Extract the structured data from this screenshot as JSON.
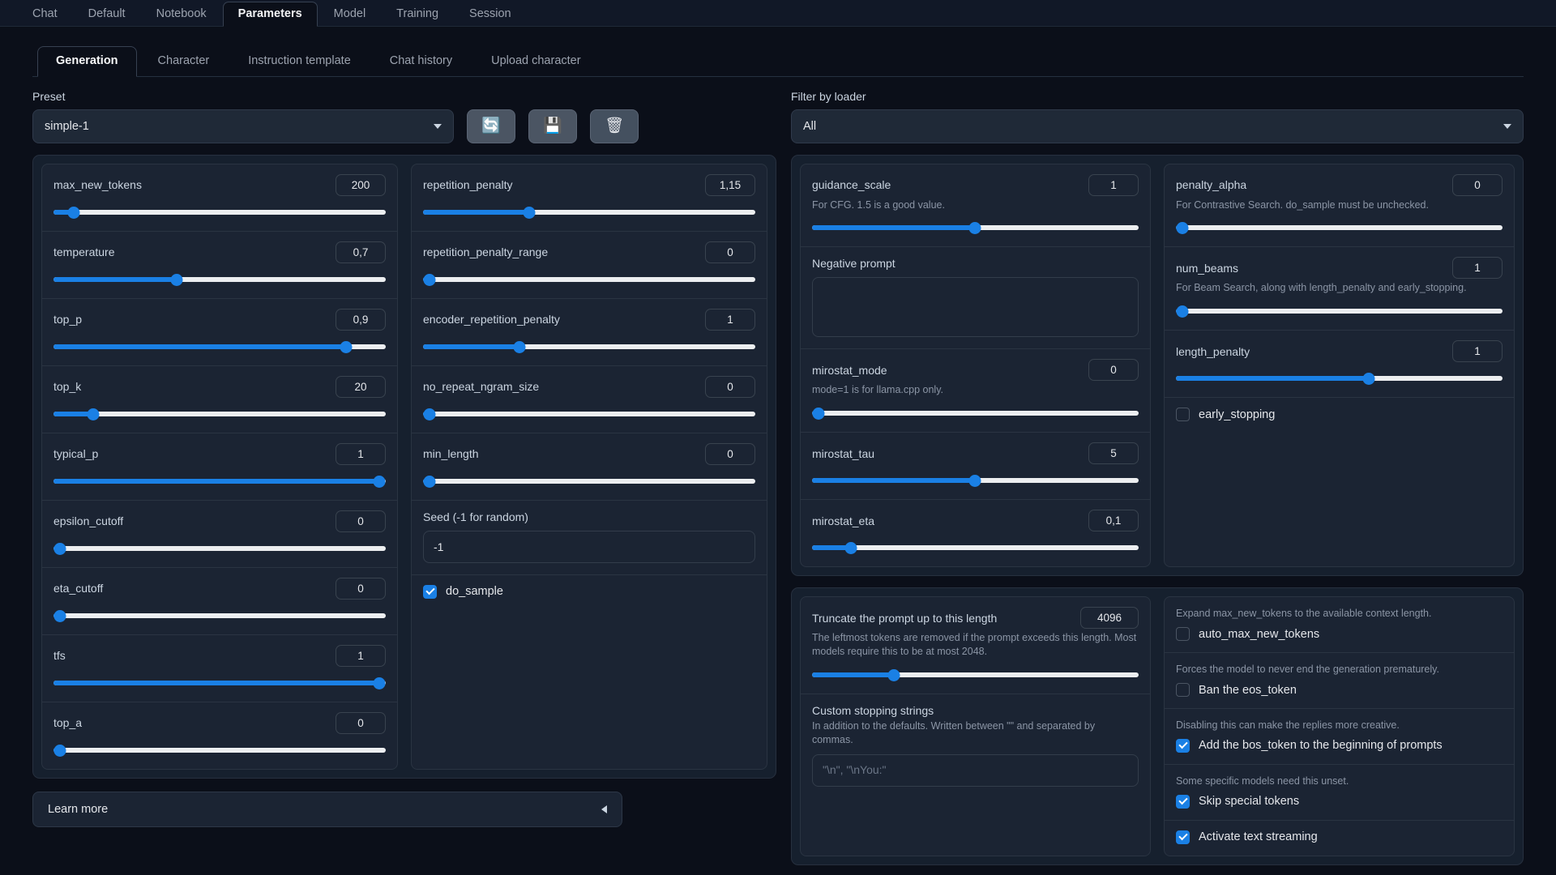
{
  "topnav": {
    "tabs": [
      {
        "label": "Chat",
        "active": false
      },
      {
        "label": "Default",
        "active": false
      },
      {
        "label": "Notebook",
        "active": false
      },
      {
        "label": "Parameters",
        "active": true
      },
      {
        "label": "Model",
        "active": false
      },
      {
        "label": "Training",
        "active": false
      },
      {
        "label": "Session",
        "active": false
      }
    ]
  },
  "subnav": {
    "tabs": [
      {
        "label": "Generation",
        "active": true
      },
      {
        "label": "Character",
        "active": false
      },
      {
        "label": "Instruction template",
        "active": false
      },
      {
        "label": "Chat history",
        "active": false
      },
      {
        "label": "Upload character",
        "active": false
      }
    ]
  },
  "preset": {
    "label": "Preset",
    "value": "simple-1",
    "buttons": [
      {
        "name": "refresh-preset-button",
        "glyph": "🔄"
      },
      {
        "name": "save-preset-button",
        "glyph": "💾"
      },
      {
        "name": "delete-preset-button",
        "glyph": "🗑"
      }
    ]
  },
  "loader_filter": {
    "label": "Filter by loader",
    "value": "All"
  },
  "column_a": [
    {
      "name": "max_new_tokens",
      "value": "200",
      "pct": 6
    },
    {
      "name": "temperature",
      "value": "0,7",
      "pct": 37
    },
    {
      "name": "top_p",
      "value": "0,9",
      "pct": 88
    },
    {
      "name": "top_k",
      "value": "20",
      "pct": 12
    },
    {
      "name": "typical_p",
      "value": "1",
      "pct": 98
    },
    {
      "name": "epsilon_cutoff",
      "value": "0",
      "pct": 2
    },
    {
      "name": "eta_cutoff",
      "value": "0",
      "pct": 2
    },
    {
      "name": "tfs",
      "value": "1",
      "pct": 98
    },
    {
      "name": "top_a",
      "value": "0",
      "pct": 2
    }
  ],
  "column_b": [
    {
      "name": "repetition_penalty",
      "value": "1,15",
      "pct": 32
    },
    {
      "name": "repetition_penalty_range",
      "value": "0",
      "pct": 2
    },
    {
      "name": "encoder_repetition_penalty",
      "value": "1",
      "pct": 29
    },
    {
      "name": "no_repeat_ngram_size",
      "value": "0",
      "pct": 2
    },
    {
      "name": "min_length",
      "value": "0",
      "pct": 2
    }
  ],
  "seed": {
    "label": "Seed (-1 for random)",
    "value": "-1"
  },
  "do_sample": {
    "label": "do_sample",
    "checked": true
  },
  "learn_more": {
    "label": "Learn more"
  },
  "column_c": {
    "guidance_scale": {
      "name": "guidance_scale",
      "value": "1",
      "hint": "For CFG. 1.5 is a good value.",
      "pct": 50
    },
    "negative_prompt": {
      "label": "Negative prompt",
      "value": ""
    },
    "mirostat_mode": {
      "name": "mirostat_mode",
      "value": "0",
      "hint": "mode=1 is for llama.cpp only.",
      "pct": 2
    },
    "mirostat_tau": {
      "name": "mirostat_tau",
      "value": "5",
      "pct": 50
    },
    "mirostat_eta": {
      "name": "mirostat_eta",
      "value": "0,1",
      "pct": 12
    }
  },
  "column_d": {
    "penalty_alpha": {
      "name": "penalty_alpha",
      "value": "0",
      "hint": "For Contrastive Search. do_sample must be unchecked.",
      "pct": 2
    },
    "num_beams": {
      "name": "num_beams",
      "value": "1",
      "hint": "For Beam Search, along with length_penalty and early_stopping.",
      "pct": 2
    },
    "length_penalty": {
      "name": "length_penalty",
      "value": "1",
      "pct": 59
    },
    "early_stopping": {
      "label": "early_stopping",
      "checked": false
    }
  },
  "truncate": {
    "label": "Truncate the prompt up to this length",
    "value": "4096",
    "hint": "The leftmost tokens are removed if the prompt exceeds this length. Most models require this to be at most 2048.",
    "pct": 25
  },
  "stopping_strings": {
    "label": "Custom stopping strings",
    "hint": "In addition to the defaults. Written between \"\" and separated by commas.",
    "placeholder": "\"\\n\", \"\\nYou:\""
  },
  "toggles": [
    {
      "hint": "Expand max_new_tokens to the available context length.",
      "label": "auto_max_new_tokens",
      "checked": false
    },
    {
      "hint": "Forces the model to never end the generation prematurely.",
      "label": "Ban the eos_token",
      "checked": false
    },
    {
      "hint": "Disabling this can make the replies more creative.",
      "label": "Add the bos_token to the beginning of prompts",
      "checked": true
    },
    {
      "hint": "Some specific models need this unset.",
      "label": "Skip special tokens",
      "checked": true
    },
    {
      "hint": "",
      "label": "Activate text streaming",
      "checked": true
    }
  ],
  "colors": {
    "accent": "#1a80e5",
    "bg": "#0b0f19",
    "panel": "#16202e"
  }
}
